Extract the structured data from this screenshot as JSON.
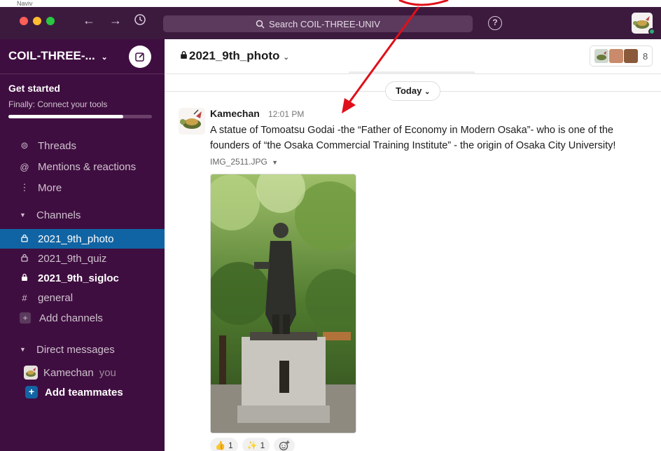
{
  "window": {
    "corner_label": "Naviv",
    "traffic_colors": {
      "close": "#fe5f57",
      "minimize": "#febc2e",
      "zoom": "#28c840"
    },
    "search_placeholder": "Search COIL-THREE-UNIV",
    "help_symbol": "?"
  },
  "sidebar": {
    "workspace_name": "COIL-THREE-...",
    "get_started": {
      "title": "Get started",
      "subtitle": "Finally: Connect your tools",
      "progress": 0.8
    },
    "nav": [
      {
        "label": "Threads",
        "icon": "threads-icon",
        "glyph": "⊜"
      },
      {
        "label": "Mentions & reactions",
        "icon": "at-icon",
        "glyph": "@"
      },
      {
        "label": "More",
        "icon": "more-vertical-icon",
        "glyph": "⋮"
      }
    ],
    "channels_header": "Channels",
    "channels": [
      {
        "label": "2021_9th_photo",
        "icon": "lock-icon",
        "glyph": "🔒",
        "active": true,
        "bold": false
      },
      {
        "label": "2021_9th_quiz",
        "icon": "lock-icon",
        "glyph": "🔒",
        "active": false,
        "bold": false
      },
      {
        "label": "2021_9th_sigloc",
        "icon": "lock-icon",
        "glyph": "🔒",
        "active": false,
        "bold": true
      },
      {
        "label": "general",
        "icon": "hash-icon",
        "glyph": "#",
        "active": false,
        "bold": false
      }
    ],
    "add_channels": "Add channels",
    "dm_header": "Direct messages",
    "dm_user": "Kamechan",
    "dm_you": "you",
    "add_teammates": "Add teammates",
    "colors": {
      "background": "#3f0e40",
      "active": "#1164a3"
    }
  },
  "channel": {
    "name": "2021_9th_photo",
    "member_count": "8",
    "date_divider": "Today"
  },
  "message": {
    "author": "Kamechan",
    "time": "12:01 PM",
    "text": "A statue of Tomoatsu Godai -the “Father of Economy in Modern Osaka”- who is one of the founders of “the Osaka Commercial Training Institute” - the origin of Osaka City University!",
    "file_name": "IMG_2511.JPG",
    "reactions": [
      {
        "emoji": "👍",
        "count": "1"
      },
      {
        "emoji": "✨",
        "count": "1"
      }
    ],
    "add_reaction_icon": "add-emoji-icon"
  }
}
